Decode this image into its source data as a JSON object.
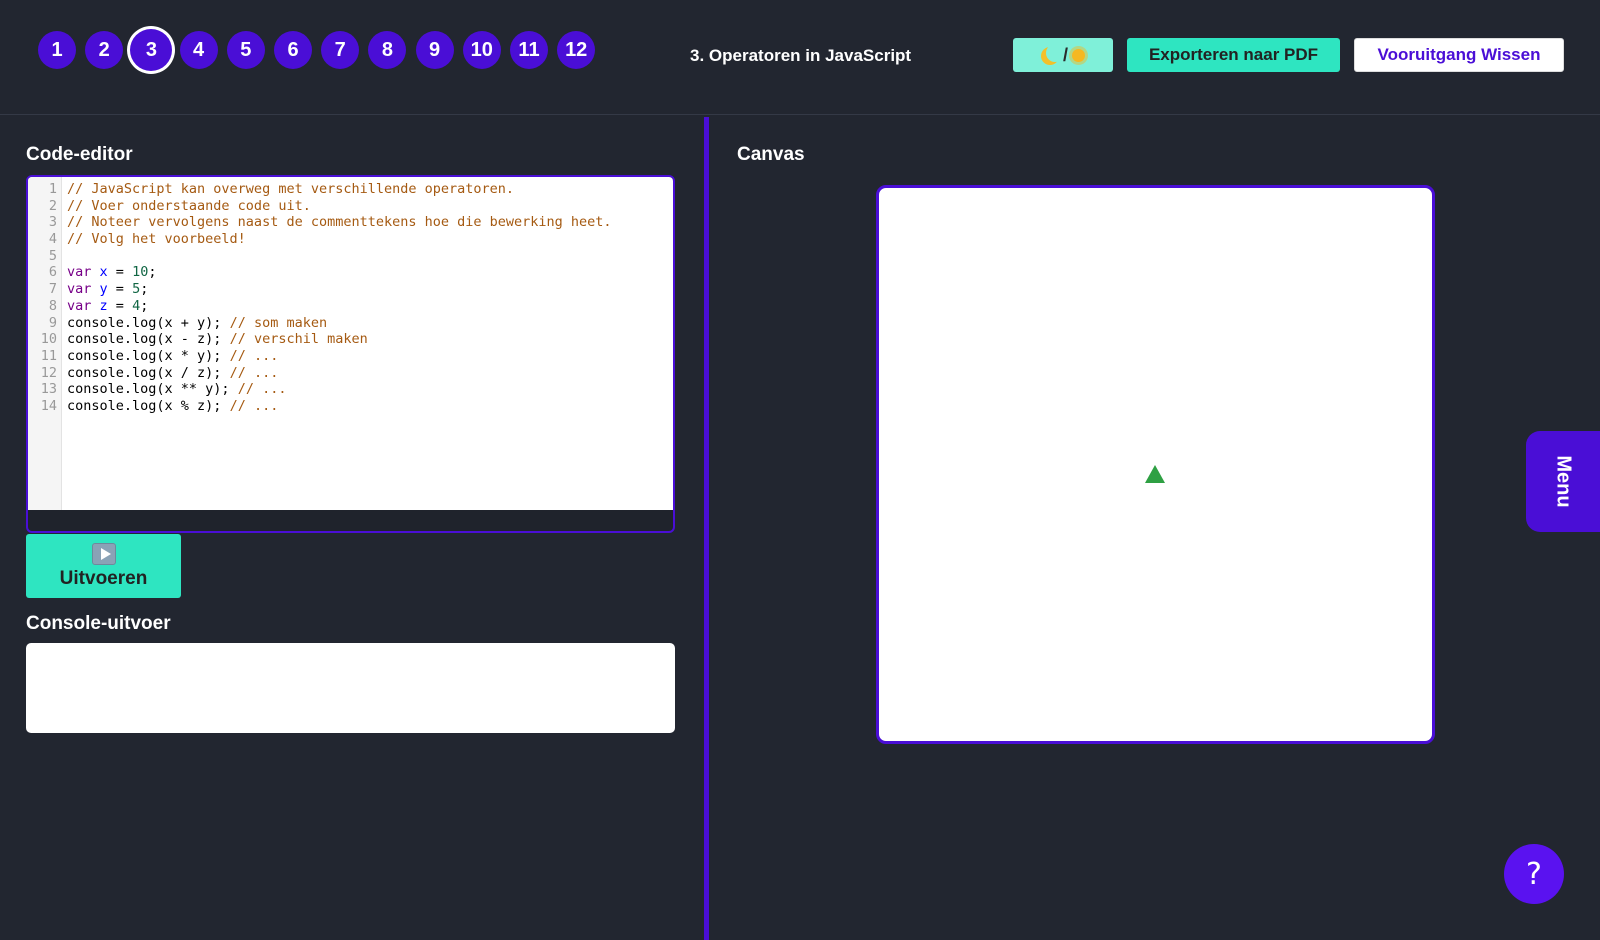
{
  "steps": [
    "1",
    "2",
    "3",
    "4",
    "5",
    "6",
    "7",
    "8",
    "9",
    "10",
    "11",
    "12"
  ],
  "active_step": "3",
  "header": {
    "lesson_title": "3. Operatoren in JavaScript",
    "theme_separator": "/",
    "theme_icons": [
      "moon-icon",
      "sun-icon"
    ],
    "export_label": "Exporteren naar PDF",
    "reset_label": "Vooruitgang Wissen"
  },
  "editor": {
    "title": "Code-editor",
    "lines": [
      [
        {
          "t": "// JavaScript kan overweg met verschillende operatoren.",
          "c": "com"
        }
      ],
      [
        {
          "t": "// Voer onderstaande code uit.",
          "c": "com"
        }
      ],
      [
        {
          "t": "// Noteer vervolgens naast de commenttekens hoe die bewerking heet.",
          "c": "com"
        }
      ],
      [
        {
          "t": "// Volg het voorbeeld!",
          "c": "com"
        }
      ],
      [],
      [
        {
          "t": "var",
          "c": "kw"
        },
        {
          "t": " "
        },
        {
          "t": "x",
          "c": "var"
        },
        {
          "t": " = "
        },
        {
          "t": "10",
          "c": "num"
        },
        {
          "t": ";"
        }
      ],
      [
        {
          "t": "var",
          "c": "kw"
        },
        {
          "t": " "
        },
        {
          "t": "y",
          "c": "var"
        },
        {
          "t": " = "
        },
        {
          "t": "5",
          "c": "num"
        },
        {
          "t": ";"
        }
      ],
      [
        {
          "t": "var",
          "c": "kw"
        },
        {
          "t": " "
        },
        {
          "t": "z",
          "c": "var"
        },
        {
          "t": " = "
        },
        {
          "t": "4",
          "c": "num"
        },
        {
          "t": ";"
        }
      ],
      [
        {
          "t": "console.log(x + y); "
        },
        {
          "t": "// som maken",
          "c": "com"
        }
      ],
      [
        {
          "t": "console.log(x - z); "
        },
        {
          "t": "// verschil maken",
          "c": "com"
        }
      ],
      [
        {
          "t": "console.log(x * y); "
        },
        {
          "t": "// ...",
          "c": "com"
        }
      ],
      [
        {
          "t": "console.log(x / z); "
        },
        {
          "t": "// ...",
          "c": "com"
        }
      ],
      [
        {
          "t": "console.log(x ** y); "
        },
        {
          "t": "// ...",
          "c": "com"
        }
      ],
      [
        {
          "t": "console.log(x % z); "
        },
        {
          "t": "// ...",
          "c": "com"
        }
      ]
    ]
  },
  "run_button": {
    "label": "Uitvoeren",
    "icon": "play-icon"
  },
  "console": {
    "title": "Console-uitvoer",
    "output": ""
  },
  "canvas": {
    "title": "Canvas",
    "turtle_icon": "turtle-icon",
    "turtle_color": "#2ea043"
  },
  "menu_tab": {
    "label": "Menu"
  },
  "help_button": {
    "label": "?"
  },
  "colors": {
    "accent": "#4a0ed6",
    "teal": "#2ee5c1",
    "background": "#222630"
  }
}
